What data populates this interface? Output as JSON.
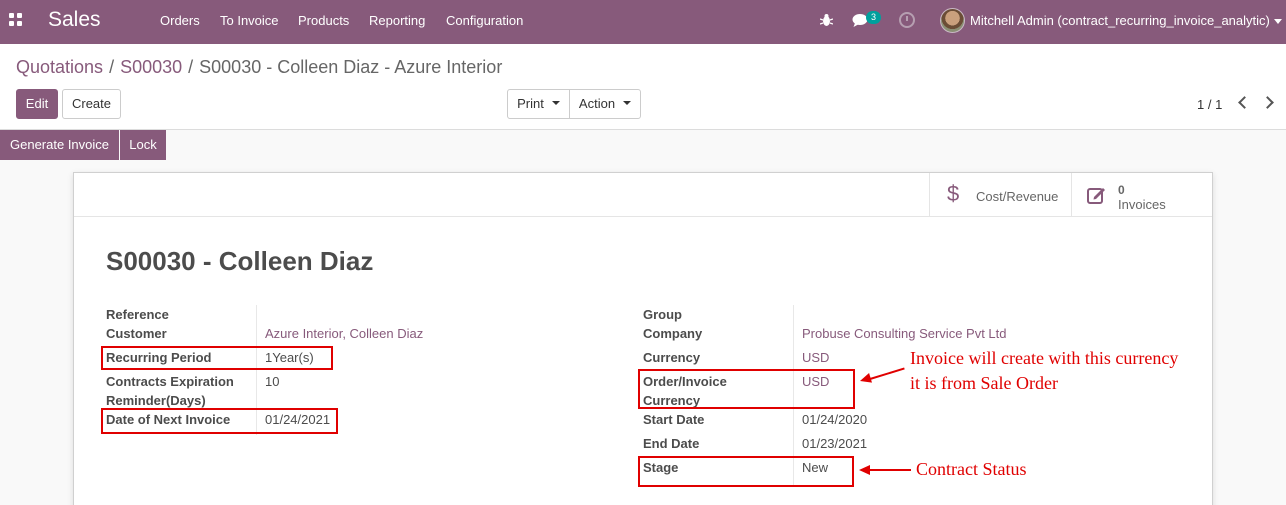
{
  "navbar": {
    "app_name": "Sales",
    "menu": [
      "Orders",
      "To Invoice",
      "Products",
      "Reporting",
      "Configuration"
    ],
    "chat_badge": "3",
    "user_name": "Mitchell Admin (contract_recurring_invoice_analytic)",
    "icons": [
      "apps-grid-icon",
      "bug-icon",
      "chat-icon",
      "clock-icon"
    ]
  },
  "breadcrumb": {
    "items": [
      "Quotations",
      "S00030"
    ],
    "active": "S00030 - Colleen Diaz - Azure Interior"
  },
  "buttons": {
    "edit": "Edit",
    "create": "Create",
    "print": "Print",
    "action": "Action"
  },
  "pager": {
    "value": "1 / 1"
  },
  "statusbar": {
    "generate_invoice": "Generate Invoice",
    "lock": "Lock"
  },
  "smart_buttons": {
    "cost_revenue": {
      "label": "Cost/Revenue",
      "icon": "dollar-icon"
    },
    "invoices": {
      "value": "0",
      "label": "Invoices",
      "icon": "edit-icon"
    }
  },
  "record": {
    "title": "S00030 - Colleen Diaz",
    "left": [
      {
        "label": "Reference",
        "value": ""
      },
      {
        "label": "Customer",
        "value": "Azure Interior, Colleen Diaz"
      },
      {
        "label": "Recurring Period",
        "value": "1Year(s)"
      },
      {
        "label": "Contracts Expiration",
        "label2": "Reminder(Days)",
        "value": "10"
      },
      {
        "label": "Date of Next Invoice",
        "value": "01/24/2021"
      }
    ],
    "right": [
      {
        "label": "Group",
        "value": ""
      },
      {
        "label": "Company",
        "value": "Probuse Consulting Service Pvt Ltd"
      },
      {
        "label": "Currency",
        "value": "USD"
      },
      {
        "label": "Order/Invoice",
        "label2": "Currency",
        "value": "USD"
      },
      {
        "label": "Start Date",
        "value": "01/24/2020"
      },
      {
        "label": "End Date",
        "value": "01/23/2021"
      },
      {
        "label": "Stage",
        "value": "New"
      }
    ]
  },
  "annotations": {
    "currency_note_line1": "Invoice will create with this currency",
    "currency_note_line2": "it is from Sale Order",
    "status_note": "Contract Status",
    "color": "#e00000"
  },
  "colors": {
    "brand": "#875a7b",
    "link": "#875a7b",
    "badge": "#00a09d"
  }
}
